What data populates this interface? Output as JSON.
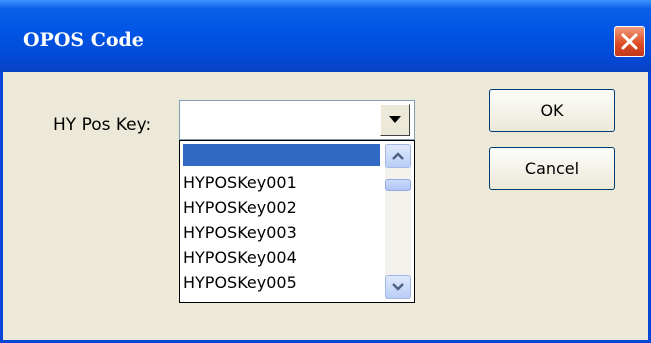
{
  "window": {
    "title": "OPOS Code"
  },
  "form": {
    "label": "HY Pos Key:",
    "combo_value": "",
    "dropdown_items": [
      "",
      "HYPOSKey001",
      "HYPOSKey002",
      "HYPOSKey003",
      "HYPOSKey004",
      "HYPOSKey005"
    ],
    "selected_index": 0
  },
  "buttons": {
    "ok": "OK",
    "cancel": "Cancel"
  },
  "colors": {
    "titlebar": "#0055e5",
    "selection": "#316ac5",
    "dialog_bg": "#ece9d8"
  }
}
